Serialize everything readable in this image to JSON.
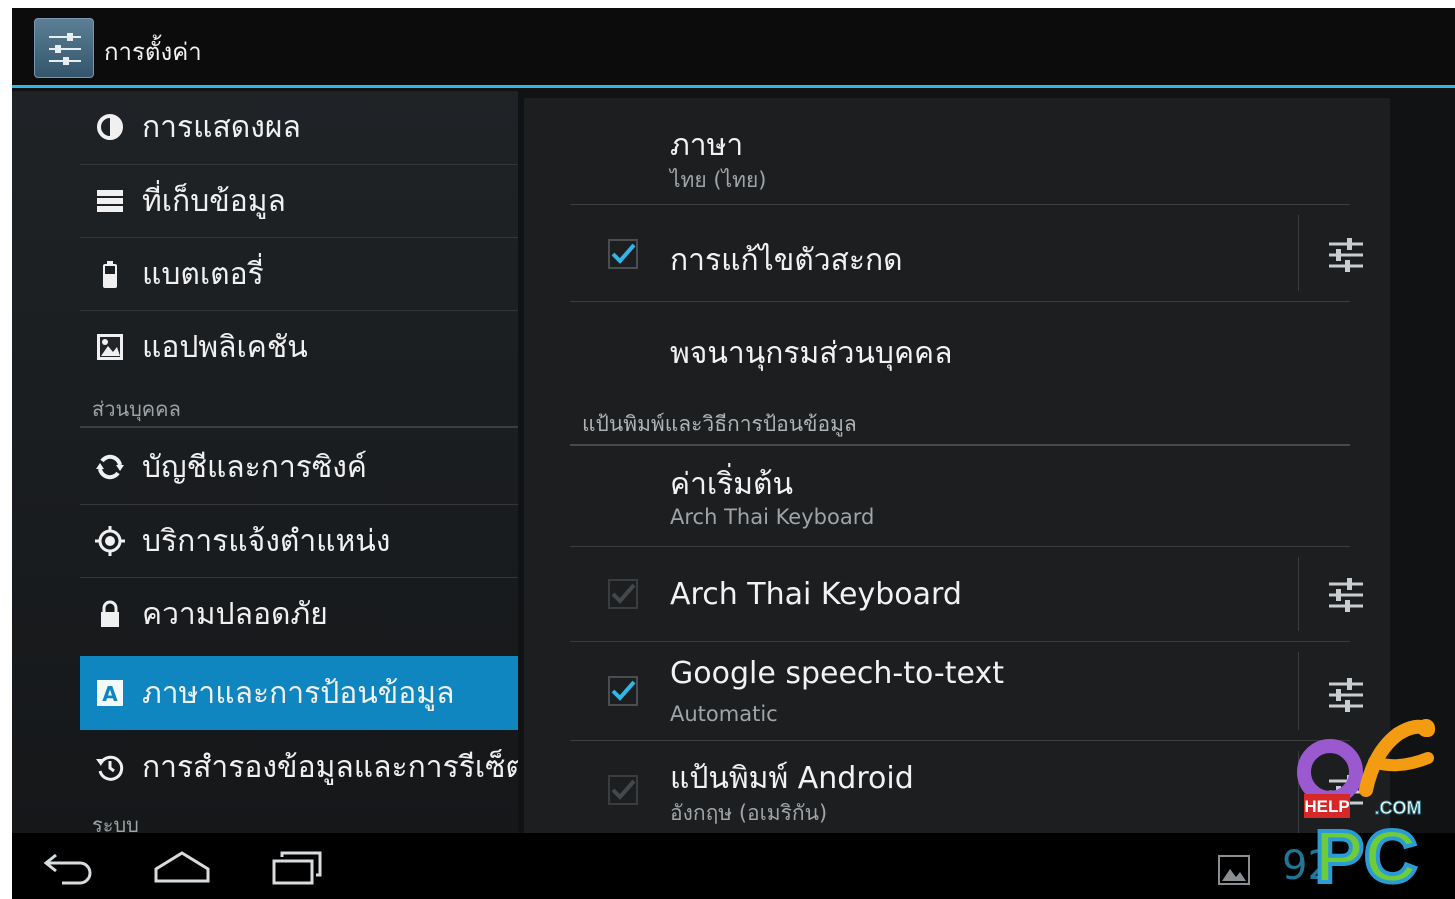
{
  "app": {
    "title": "การตั้งค่า",
    "accent": "#33b5e5",
    "selected_color": "#0f86c0"
  },
  "sidebar": {
    "items": [
      {
        "label": "การแสดงผล",
        "icon": "brightness-icon"
      },
      {
        "label": "ที่เก็บข้อมูล",
        "icon": "storage-icon"
      },
      {
        "label": "แบตเตอรี่",
        "icon": "battery-icon"
      },
      {
        "label": "แอปพลิเคชัน",
        "icon": "apps-icon"
      },
      {
        "label": "บัญชีและการซิงค์",
        "icon": "sync-icon"
      },
      {
        "label": "บริการแจ้งตำแหน่ง",
        "icon": "location-icon"
      },
      {
        "label": "ความปลอดภัย",
        "icon": "lock-icon"
      },
      {
        "label": "ภาษาและการป้อนข้อมูล",
        "icon": "language-icon",
        "selected": true
      },
      {
        "label": "การสำรองข้อมูลและการรีเซ็ต",
        "icon": "backup-icon"
      }
    ],
    "section_personal": "ส่วนบุคคล",
    "section_system": "ระบบ"
  },
  "content": {
    "language": {
      "title": "ภาษา",
      "value": "ไทย (ไทย)"
    },
    "spell_checker": {
      "title": "การแก้ไขตัวสะกด",
      "checked": true
    },
    "personal_dictionary": {
      "title": "พจนานุกรมส่วนบุคคล"
    },
    "keyboard_section_header": "แป้นพิมพ์และวิธีการป้อนข้อมูล",
    "default": {
      "title": "ค่าเริ่มต้น",
      "value": "Arch Thai Keyboard"
    },
    "arch_thai": {
      "title": "Arch Thai Keyboard",
      "checked": true,
      "disabled": true
    },
    "google_speech": {
      "title": "Google speech-to-text",
      "subtitle": "Automatic",
      "checked": true
    },
    "android_keyboard": {
      "title": "แป้นพิมพ์ Android",
      "subtitle": "อังกฤษ (อเมริกัน)",
      "checked": true,
      "disabled": true
    }
  },
  "navbar": {
    "back": "back-icon",
    "home": "home-icon",
    "recents": "recents-icon",
    "status": "92"
  },
  "watermark": {
    "top": "HELP",
    "com": ".COM",
    "main": "PC"
  }
}
